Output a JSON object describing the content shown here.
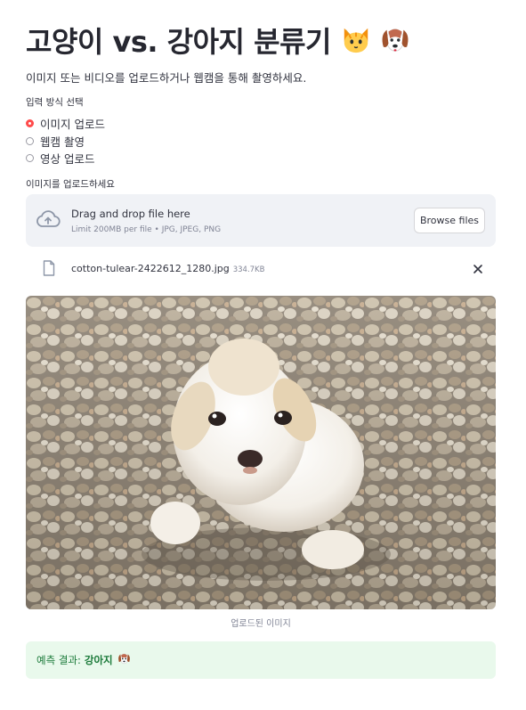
{
  "title": {
    "text": "고양이 vs. 강아지 분류기",
    "emoji_icons": [
      "cat-face-icon",
      "dog-face-icon"
    ]
  },
  "description": "이미지 또는 비디오를 업로드하거나 웹캠을 통해 촬영하세요.",
  "input_method": {
    "label": "입력 방식 선택",
    "options": [
      {
        "label": "이미지 업로드",
        "selected": true
      },
      {
        "label": "웹캠 촬영",
        "selected": false
      },
      {
        "label": "영상 업로드",
        "selected": false
      }
    ]
  },
  "uploader": {
    "label": "이미지를 업로드하세요",
    "drop_text": "Drag and drop file here",
    "limit_text": "Limit 200MB per file • JPG, JPEG, PNG",
    "browse_label": "Browse files",
    "icon": "cloud-upload-icon"
  },
  "uploaded_file": {
    "name": "cotton-tulear-2422612_1280.jpg",
    "size": "334.7KB",
    "icon": "file-icon"
  },
  "image": {
    "caption": "업로드된 이미지"
  },
  "result": {
    "prefix": "예측 결과:",
    "value": "강아지",
    "icon": "dog-face-icon"
  },
  "colors": {
    "accent": "#ff4b4b",
    "dropzone_bg": "#f0f2f6",
    "success_bg": "#e9f9ec",
    "success_text": "#1b7a3a"
  }
}
